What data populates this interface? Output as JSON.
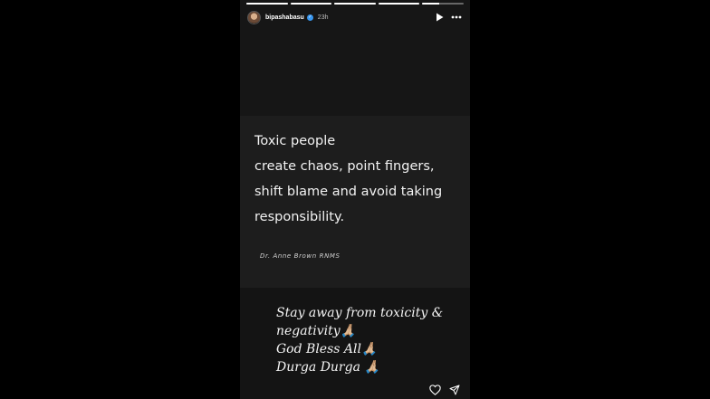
{
  "story": {
    "progress_segments": [
      {
        "fill": 1.0
      },
      {
        "fill": 1.0
      },
      {
        "fill": 1.0
      },
      {
        "fill": 1.0
      },
      {
        "fill": 0.4
      }
    ],
    "header": {
      "username": "bipashabasu",
      "verified_icon": "verified-badge-icon",
      "time": "23h",
      "play_icon": "play-icon",
      "more_icon": "more-options-icon"
    },
    "quote": {
      "lines": [
        "Toxic people",
        "create chaos, point fingers,",
        "shift blame and avoid taking",
        "responsibility."
      ],
      "author": "Dr. Anne Brown RNMS"
    },
    "caption": {
      "lines": [
        "Stay away from toxicity &",
        "negativity🙏🏼",
        "God Bless All🙏🏼",
        "Durga Durga 🙏🏼"
      ]
    },
    "footer": {
      "like_icon": "heart-icon",
      "share_icon": "send-icon"
    },
    "colors": {
      "background": "#000000",
      "story_bg": "#1b1b1b",
      "text": "#f2f2f2",
      "verified": "#3897f0"
    }
  }
}
